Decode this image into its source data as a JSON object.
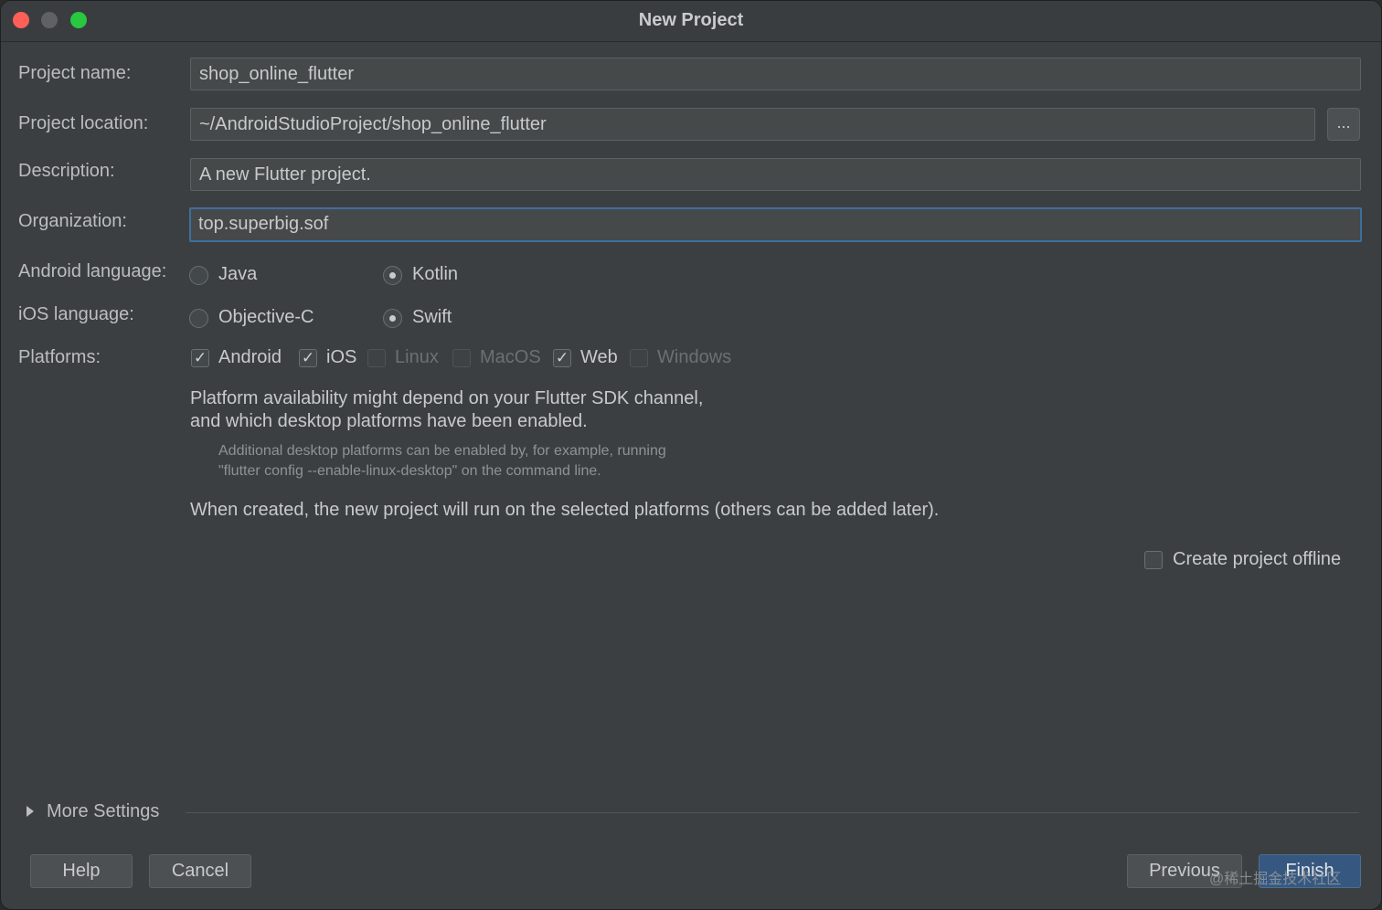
{
  "window": {
    "title": "New Project"
  },
  "form": {
    "project_name": {
      "label": "Project name:",
      "value": "shop_online_flutter"
    },
    "project_location": {
      "label": "Project location:",
      "value": "~/AndroidStudioProject/shop_online_flutter",
      "browse_label": "..."
    },
    "description": {
      "label": "Description:",
      "value": "A new Flutter project."
    },
    "organization": {
      "label": "Organization:",
      "value": "top.superbig.sof"
    },
    "android_language": {
      "label": "Android language:",
      "options": [
        "Java",
        "Kotlin"
      ],
      "selected": "Kotlin"
    },
    "ios_language": {
      "label": "iOS language:",
      "options": [
        "Objective-C",
        "Swift"
      ],
      "selected": "Swift"
    },
    "platforms": {
      "label": "Platforms:",
      "items": [
        {
          "label": "Android",
          "checked": true,
          "enabled": true
        },
        {
          "label": "iOS",
          "checked": true,
          "enabled": true
        },
        {
          "label": "Linux",
          "checked": false,
          "enabled": false
        },
        {
          "label": "MacOS",
          "checked": false,
          "enabled": false
        },
        {
          "label": "Web",
          "checked": true,
          "enabled": true
        },
        {
          "label": "Windows",
          "checked": false,
          "enabled": false
        }
      ]
    }
  },
  "notes": {
    "availability_line1": "Platform availability might depend on your Flutter SDK channel,",
    "availability_line2": "and which desktop platforms have been enabled.",
    "hint_line1": "Additional desktop platforms can be enabled by, for example, running",
    "hint_line2": "\"flutter config --enable-linux-desktop\" on the command line.",
    "when_created": "When created, the new project will run on the selected platforms (others can be added later)."
  },
  "offline": {
    "label": "Create project offline",
    "checked": false
  },
  "more_settings": {
    "label": "More Settings"
  },
  "buttons": {
    "help": "Help",
    "cancel": "Cancel",
    "previous": "Previous",
    "finish": "Finish"
  },
  "watermark": "@稀土掘金技术社区"
}
